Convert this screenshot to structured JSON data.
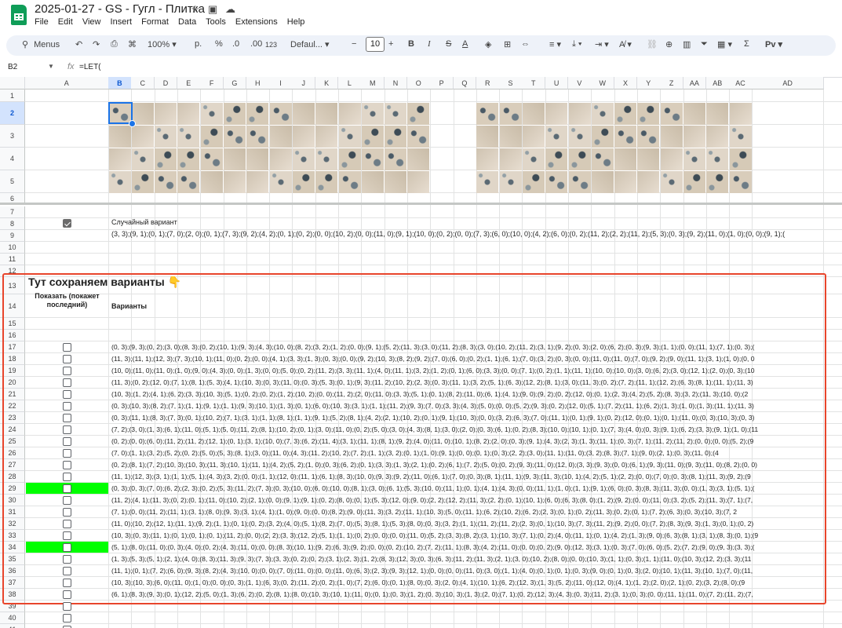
{
  "doc": {
    "title": "2025-01-27 - GS - Гугл - Плитка",
    "menu": [
      "File",
      "Edit",
      "View",
      "Insert",
      "Format",
      "Data",
      "Tools",
      "Extensions",
      "Help"
    ]
  },
  "toolbar": {
    "search": "Menus",
    "zoom": "100%",
    "currency": "р.",
    "percent": "%",
    "dec_dec": ".0",
    "dec_inc": ".00",
    "num_format": "123",
    "font": "Defaul...",
    "font_size": "10",
    "minus": "−",
    "plus": "+",
    "bold": "B",
    "italic": "I",
    "strike": "S",
    "text_color": "A",
    "sigma": "Σ",
    "input_tools": "Рv"
  },
  "formula_bar": {
    "name_box": "B2",
    "fx": "fx",
    "formula": "=LET("
  },
  "columns": [
    "A",
    "B",
    "C",
    "D",
    "E",
    "F",
    "G",
    "H",
    "I",
    "J",
    "K",
    "L",
    "M",
    "N",
    "O",
    "P",
    "Q",
    "R",
    "S",
    "T",
    "U",
    "V",
    "W",
    "X",
    "Y",
    "Z",
    "AA",
    "AB",
    "AC",
    "AD"
  ],
  "rows": [
    "1",
    "2",
    "3",
    "4",
    "5",
    "6",
    "7",
    "8",
    "9",
    "10",
    "11",
    "12",
    "13",
    "14",
    "15",
    "16",
    "17",
    "18",
    "19",
    "20",
    "21",
    "22",
    "23",
    "24",
    "25",
    "26",
    "27",
    "28",
    "29",
    "30",
    "31",
    "32",
    "33",
    "34",
    "35",
    "36",
    "37",
    "38",
    "39",
    "40",
    "41"
  ],
  "sheet": {
    "random_label": "Случайный вариант",
    "random_variant": "(3, 3);(9, 1);(0, 1);(7, 0);(2, 0);(0, 1);(7, 3);(9, 2);(4, 2);(0, 1);(0, 2);(0, 0);(10, 2);(0, 0);(11, 0);(9, 1);(10, 0);(0, 2);(0, 0);(7, 3);(6, 0);(10, 0);(4, 2);(6, 0);(0, 2);(11, 2);(2, 2);(11, 2);(5, 3);(0, 3);(9, 2);(11, 0);(1, 0);(0, 0);(9, 1);(",
    "heading": "Тут сохраняем варианты 👇",
    "show_header": "Показать (покажет последний)",
    "variants_header": "Варианты",
    "variants": [
      "(0, 3);(9, 3);(0, 2);(3, 0);(8, 3);(0, 2);(10, 1);(9, 3);(4, 3);(10, 0);(8, 2);(3, 2);(1, 2);(0, 0);(9, 1);(5, 2);(11, 3);(3, 0);(11, 2);(8, 3);(3, 0);(10, 2);(11, 2);(3, 1);(9, 2);(0, 3);(2, 0);(6, 2);(0, 3);(9, 3);(1, 1);(0, 0);(11, 1);(7, 1);(0, 3);(",
      "(11, 3);(11, 1);(12, 3);(7, 3);(10, 1);(11, 0);(0, 2);(0, 0);(4, 1);(3, 3);(1, 3);(0, 3);(0, 0);(9, 2);(10, 3);(8, 2);(9, 2);(7, 0);(6, 0);(0, 2);(1, 1);(6, 1);(7, 0);(3, 2);(0, 3);(0, 0);(11, 0);(11, 0);(7, 0);(9, 2);(9, 0);(11, 1);(3, 1);(1, 0);(0, 0",
      "(10, 0);(11, 0);(11, 0);(1, 0);(9, 0);(4, 3);(0, 0);(1, 3);(0, 0);(5, 0);(0, 2);(11, 2);(3, 3);(11, 1);(4, 0);(11, 1);(3, 2);(1, 2);(0, 1);(6, 0);(3, 3);(0, 0);(7, 1);(0, 2);(1, 1);(11, 1);(10, 0);(10, 0);(3, 0);(6, 2);(3, 0);(12, 1);(2, 0);(0, 3);(10",
      "(11, 3);(0, 2);(12, 0);(7, 1);(8, 1);(5, 3);(4, 1);(10, 3);(0, 3);(11, 0);(0, 3);(5, 3);(0, 1);(9, 3);(11, 2);(10, 2);(2, 3);(0, 3);(11, 1);(3, 2);(5, 1);(6, 3);(12, 2);(8, 1);(3, 0);(11, 3);(0, 2);(7, 2);(11, 1);(12, 2);(6, 3);(8, 1);(11, 1);(11, 3)",
      "(10, 3);(1, 2);(4, 1);(6, 2);(3, 3);(10, 3);(5, 1);(0, 2);(0, 2);(1, 2);(10, 2);(0, 0);(11, 2);(2, 0);(11, 0);(3, 3);(5, 1);(0, 1);(8, 2);(11, 0);(6, 1);(4, 1);(9, 0);(9, 2);(0, 2);(12, 0);(0, 1);(2, 3);(4, 2);(5, 2);(8, 3);(3, 2);(11, 3);(10, 0);(2",
      "(0, 3);(10, 3);(8, 2);(7, 1);(1, 1);(9, 1);(1, 1);(9, 3);(10, 1);(1, 3);(0, 1);(6, 0);(10, 3);(3, 1);(1, 1);(11, 2);(9, 3);(7, 0);(3, 3);(4, 3);(5, 0);(0, 0);(5, 2);(9, 3);(0, 2);(12, 0);(5, 1);(7, 2);(11, 1);(6, 2);(1, 3);(1, 0);(1, 3);(11, 1);(11, 3)",
      "(0, 3);(11, 1);(8, 3);(7, 3);(0, 1);(10, 2);(7, 1);(3, 1);(1, 1);(8, 1);(1, 1);(9, 1);(5, 2);(8, 1);(4, 2);(2, 1);(10, 2);(0, 1);(9, 1);(10, 3);(0, 0);(3, 2);(6, 3);(7, 0);(11, 1);(0, 1);(9, 1);(0, 2);(12, 0);(0, 1);(0, 1);(11, 0);(0, 3);(10, 3);(0, 3)",
      "(7, 2);(3, 0);(1, 3);(6, 1);(11, 0);(5, 1);(5, 0);(11, 2);(8, 1);(10, 2);(0, 1);(3, 0);(11, 0);(0, 2);(5, 0);(3, 0);(4, 3);(8, 1);(3, 0);(2, 0);(0, 3);(6, 1);(0, 2);(8, 3);(10, 0);(10, 1);(0, 1);(7, 3);(4, 0);(0, 3);(9, 1);(6, 2);(3, 3);(9, 1);(1, 0);(11",
      "(0, 2);(0, 0);(6, 0);(11, 2);(11, 2);(12, 1);(0, 1);(3, 1);(10, 0);(7, 3);(6, 2);(11, 4);(3, 1);(11, 1);(8, 1);(9, 2);(4, 0);(11, 0);(10, 1);(8, 2);(2, 0);(0, 3);(9, 1);(4, 3);(2, 3);(1, 3);(11, 1);(0, 3);(7, 1);(11, 2);(11, 2);(0, 0);(0, 0);(5, 2);(9",
      "(7, 0);(1, 1);(3, 2);(5, 2);(0, 2);(5, 0);(5, 3);(8, 1);(3, 0);(11, 0);(4, 3);(11, 2);(10, 2);(7, 2);(1, 1);(3, 2);(0, 1);(1, 0);(9, 1);(0, 0);(0, 1);(0, 3);(2, 2);(3, 0);(11, 1);(11, 0);(3, 2);(8, 3);(7, 1);(9, 0);(2, 1);(0, 3);(11, 0);(4",
      "(0, 2);(8, 1);(7, 2);(10, 3);(10, 3);(11, 3);(10, 1);(11, 1);(4, 2);(5, 2);(1, 0);(0, 3);(6, 2);(0, 1);(3, 3);(1, 3);(2, 1);(0, 2);(6, 1);(7, 2);(5, 0);(0, 2);(9, 3);(11, 0);(12, 0);(3, 3);(9, 3);(0, 0);(6, 1);(9, 3);(11, 0);(9, 3);(11, 0);(8, 2);(0, 0)",
      "(11, 1);(12, 3);(3, 1);(1, 1);(5, 1);(4, 3);(3, 2);(0, 0);(1, 1);(12, 0);(11, 1);(6, 1);(8, 3);(10, 0);(9, 3);(9, 2);(11, 0);(6, 1);(7, 0);(0, 3);(8, 1);(11, 1);(9, 3);(11, 3);(10, 1);(4, 2);(5, 1);(2, 2);(0, 0);(7, 0);(0, 3);(8, 1);(11, 3);(9, 2);(9",
      "(0, 3);(0, 3);(7, 0);(6, 2);(2, 3);(0, 2);(5, 3);(11, 2);(7, 3);(0, 3);(10, 0);(6, 0);(10, 0);(8, 1);(3, 0);(6, 1);(5, 3);(10, 0);(11, 1);(0, 1);(4, 1);(4, 3);(0, 0);(11, 1);(1, 0);(1, 1);(9, 1);(6, 0);(0, 3);(8, 3);(11, 3);(0, 0);(1, 3);(3, 1);(5, 1);(",
      "(11, 2);(4, 1);(11, 3);(0, 2);(0, 1);(11, 0);(10, 2);(2, 1);(0, 0);(9, 1);(9, 1);(0, 2);(8, 0);(0, 1);(5, 3);(12, 0);(9, 0);(2, 2);(12, 2);(11, 3);(2, 2);(0, 1);(10, 1);(6, 0);(6, 3);(8, 0);(1, 2);(9, 2);(0, 0);(11, 0);(3, 2);(5, 2);(11, 3);(7, 1);(7,",
      "(7, 1);(0, 0);(11, 2);(11, 1);(3, 1);(8, 0);(9, 3);(3, 1);(4, 1);(1, 0);(9, 0);(0, 0);(8, 2);(9, 0);(11, 3);(3, 2);(11, 1);(10, 3);(5, 0);(11, 1);(6, 2);(10, 2);(6, 2);(2, 3);(0, 1);(0, 2);(11, 3);(0, 2);(0, 1);(7, 2);(6, 3);(0, 3);(10, 3);(7, 2",
      "(11, 0);(10, 2);(12, 1);(11, 1);(9, 2);(1, 1);(0, 1);(0, 2);(3, 2);(4, 0);(5, 1);(8, 2);(7, 0);(5, 3);(8, 1);(5, 3);(8, 0);(0, 3);(3, 2);(1, 1);(11, 2);(11, 2);(2, 3);(0, 1);(10, 3);(7, 3);(11, 2);(9, 2);(0, 0);(7, 2);(8, 3);(9, 3);(1, 3);(0, 1);(0, 2)",
      "(10, 3);(0, 3);(11, 1);(0, 1);(0, 1);(0, 1);(11, 2);(0, 0);(2, 2);(3, 3);(12, 2);(5, 1);(1, 1);(0, 2);(0, 0);(0, 0);(11, 0);(5, 2);(3, 3);(8, 2);(3, 1);(10, 3);(7, 1);(0, 2);(4, 0);(11, 1);(0, 1);(4, 2);(1, 3);(9, 0);(6, 3);(8, 1);(3, 1);(8, 3);(0, 1);(9",
      "(5, 1);(8, 0);(11, 0);(0, 3);(4, 0);(0, 2);(4, 3);(11, 0);(0, 0);(8, 3);(10, 1);(9, 2);(6, 3);(9, 2);(0, 0);(0, 2);(10, 2);(7, 2);(11, 1);(8, 3);(4, 2);(11, 0);(0, 0);(0, 2);(9, 0);(12, 3);(3, 1);(0, 3);(7, 0);(6, 0);(5, 2);(7, 2);(9, 0);(9, 3);(3, 3);(",
      "(1, 3);(5, 3);(5, 1);(2, 1);(4, 0);(8, 3);(11, 3);(9, 3);(7, 3);(3, 3);(0, 2);(0, 2);(3, 1);(2, 3);(1, 2);(8, 3);(12, 3);(0, 3);(6, 3);(11, 2);(11, 3);(2, 1);(3, 0);(10, 2);(8, 0);(0, 0);(10, 3);(1, 1);(0, 3);(1, 1);(11, 0);(10, 3);(12, 2);(3, 3);(11",
      "(11, 1);(0, 1);(7, 2);(6, 0);(9, 3);(8, 2);(4, 3);(10, 0);(0, 0);(7, 0);(11, 0);(0, 0);(11, 0);(6, 3);(2, 3);(9, 3);(12, 1);(0, 0);(0, 0);(11, 0);(3, 0);(1, 1);(4, 0);(0, 1);(0, 1);(0, 3);(9, 0);(0, 1);(0, 3);(2, 0);(10, 1);(11, 3);(10, 1);(7, 0);(11,",
      "(10, 3);(10, 3);(6, 0);(11, 0);(1, 0);(0, 0);(0, 3);(1, 1);(6, 3);(0, 2);(11, 2);(0, 2);(1, 0);(7, 2);(6, 0);(0, 1);(8, 0);(0, 3);(2, 0);(4, 1);(10, 1);(6, 2);(12, 3);(1, 3);(5, 2);(11, 0);(12, 0);(4, 1);(1, 2);(2, 0);(2, 1);(0, 2);(3, 2);(8, 0);(9",
      "(6, 1);(8, 3);(9, 3);(0, 1);(12, 2);(5, 0);(1, 3);(6, 2);(0, 2);(8, 1);(8, 0);(10, 3);(10, 1);(11, 0);(0, 1);(0, 3);(1, 2);(0, 3);(10, 3);(1, 3);(2, 0);(7, 1);(0, 2);(12, 3);(4, 3);(0, 3);(11, 2);(3, 1);(0, 3);(0, 0);(11, 1);(11, 0);(7, 2);(11, 2);(7,"
    ],
    "checked_rows": [
      "8"
    ],
    "highlighted_rows": [
      "29",
      "34"
    ]
  },
  "colors": {
    "accent": "#1a73e8",
    "highlight": "#00ff00",
    "frame": "#e8452c",
    "sheets_green": "#0f9d58"
  }
}
